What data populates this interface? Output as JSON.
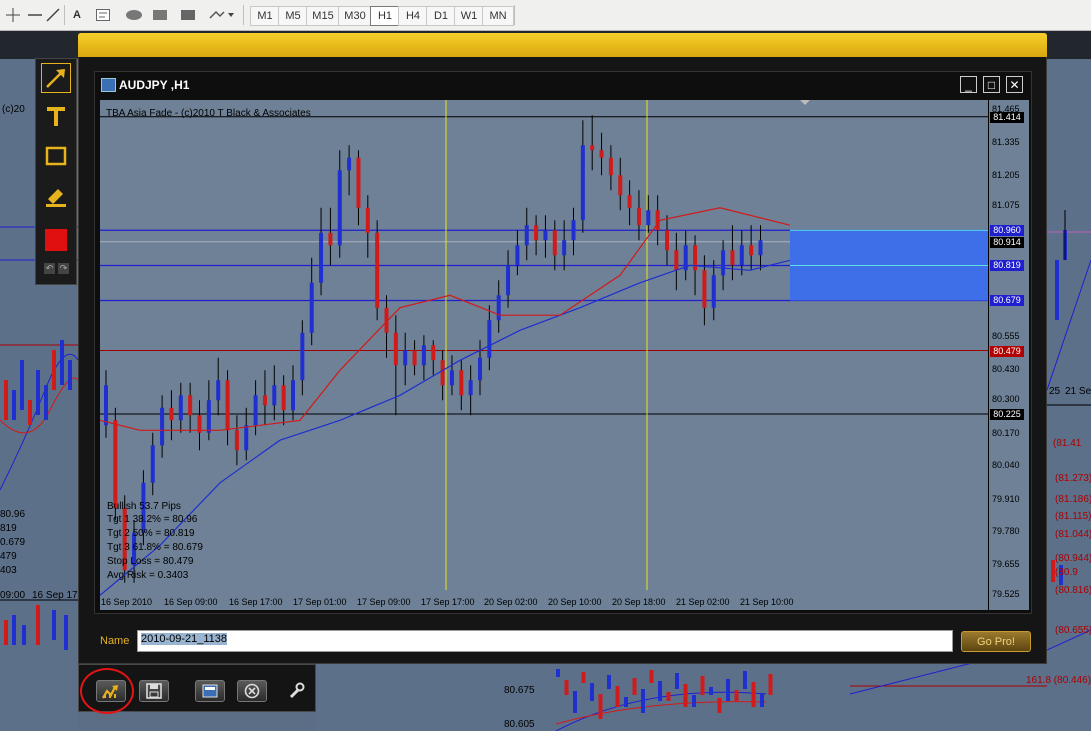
{
  "toolbar": {
    "text_tool": "A",
    "timeframes": [
      "M1",
      "M5",
      "M15",
      "M30",
      "H1",
      "H4",
      "D1",
      "W1",
      "MN"
    ],
    "active_timeframe": "H1"
  },
  "background": {
    "left_chart": {
      "header": "(c)20",
      "values": [
        "80.96",
        "819",
        "0.679",
        "479",
        "403"
      ],
      "time_labels": [
        "09:00",
        "16 Sep 17"
      ]
    },
    "right_chart": {
      "time_labels": [
        "25",
        "21 Sep"
      ],
      "price_labels": [
        "(81.41",
        "(81.273)",
        "(81.186)",
        "(81.115)",
        "(81.044)",
        "(80.944)",
        "(80.9",
        "(80.816)",
        "(80.655)",
        "161.8  (80.446)"
      ]
    },
    "bottom_prices": [
      "80.675",
      "80.605"
    ]
  },
  "window": {
    "title": "AUDJPY ,H1",
    "indicator_label": "TBA Asia Fade - (c)2010 T Black & Associates",
    "minimize": "_",
    "maximize": "□",
    "close": "✕"
  },
  "price_axis": {
    "labels": [
      "81.465",
      "81.335",
      "81.205",
      "81.075",
      "80.555",
      "80.430",
      "80.300",
      "80.170",
      "80.040",
      "79.910",
      "79.780",
      "79.655",
      "79.525"
    ],
    "boxes": [
      {
        "value": "81.414",
        "bg": "#000000",
        "fg": "#ffffff"
      },
      {
        "value": "80.960",
        "bg": "#1f1fcf",
        "fg": "#ffffff"
      },
      {
        "value": "80.914",
        "bg": "#000000",
        "fg": "#ffffff"
      },
      {
        "value": "80.819",
        "bg": "#1f1fcf",
        "fg": "#ffffff"
      },
      {
        "value": "80.679",
        "bg": "#1f1fcf",
        "fg": "#ffffff"
      },
      {
        "value": "80.479",
        "bg": "#b00000",
        "fg": "#ffffff"
      },
      {
        "value": "80.225",
        "bg": "#000000",
        "fg": "#ffffff"
      }
    ]
  },
  "time_axis": [
    "16 Sep 2010",
    "16 Sep 09:00",
    "16 Sep 17:00",
    "17 Sep 01:00",
    "17 Sep 09:00",
    "17 Sep 17:00",
    "20 Sep 02:00",
    "20 Sep 10:00",
    "20 Sep 18:00",
    "21 Sep 02:00",
    "21 Sep 10:00"
  ],
  "info": {
    "line1": "Bullish  53.7 Pips",
    "line2": "Tgt 1 38.2% = 80.96",
    "line3": "Tgt 2 50% = 80.819",
    "line4": "Tgt 3 61.8% = 80.679",
    "line5": "Stop Loss = 80.479",
    "line6": "Avg Risk = 0.3403"
  },
  "name_row": {
    "label": "Name",
    "value": "2010-09-21_1138",
    "go_button": "Go Pro!"
  },
  "colors": {
    "accent": "#e8b21c",
    "bullish": "#1f2fd0",
    "bearish": "#d11a1a",
    "target_zone": "#3f6fe8"
  }
}
